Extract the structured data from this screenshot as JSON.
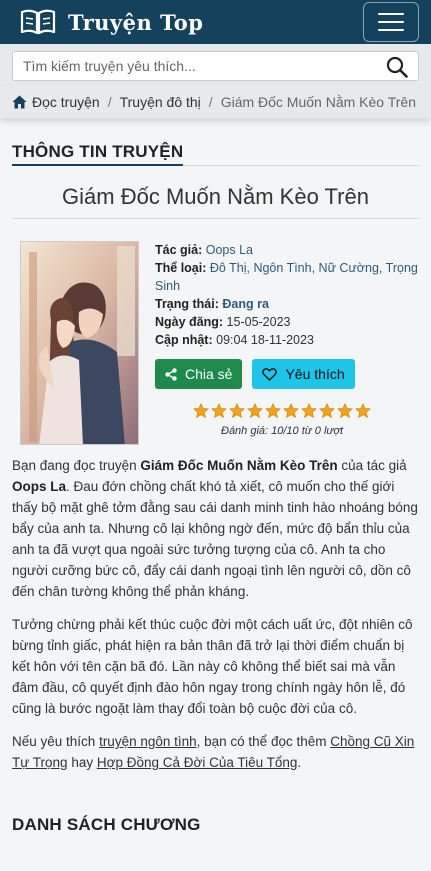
{
  "header": {
    "logo_text": "Truyện Top",
    "colors": {
      "bar": "#14425d",
      "share": "#1e8a4c",
      "favorite": "#1fc5e8",
      "star": "#f4a21b"
    }
  },
  "search": {
    "placeholder": "Tìm kiếm truyện yêu thích...",
    "value": ""
  },
  "breadcrumb": {
    "items": [
      "Đọc truyện",
      "Truyện đô thị"
    ],
    "current": "Giám Đốc Muốn Nằm Kèo Trên"
  },
  "section": {
    "info_title": "THÔNG TIN TRUYỆN",
    "chapters_title": "DANH SÁCH CHƯƠNG"
  },
  "story": {
    "title": "Giám Đốc Muốn Nằm Kèo Trên",
    "author_label": "Tác giả:",
    "author": "Oops La",
    "genre_label": "Thể loại:",
    "genres": [
      "Đô Thị",
      "Ngôn Tình",
      "Nữ Cường",
      "Trọng Sinh"
    ],
    "status_label": "Trạng thái:",
    "status": "Đang ra",
    "posted_label": "Ngày đăng:",
    "posted": "15-05-2023",
    "updated_label": "Cập nhật:",
    "updated": "09:04 18-11-2023",
    "share_label": "Chia sẻ",
    "favorite_label": "Yêu thích",
    "rating_stars_filled": 10,
    "rating_stars_total": 10,
    "rating_text": "Đánh giá: 10/10 từ 0 lượt"
  },
  "description": {
    "p1_intro": "Bạn đang đọc truyện ",
    "p1_title": "Giám Đốc Muốn Nằm Kèo Trên",
    "p1_mid": " của tác giả ",
    "p1_author": "Oops La",
    "p1_rest": ". Đau đớn chồng chất khó tả xiết, cô muốn cho thế giới thấy bộ mặt ghê tởm đằng sau cái danh minh tinh hào nhoáng bóng bẩy của anh ta. Nhưng cô lại không ngờ đến, mức độ bẩn thỉu của anh ta đã vượt qua ngoài sức tưởng tượng của cô. Anh ta cho người cưỡng bức cô, đẩy cái danh ngoại tình lên người cô, dồn cô đến chân tường không thể phản kháng.",
    "p2": "Tưởng chừng phải kết thúc cuộc đời một cách uất ức, đột nhiên cô bừng tỉnh giấc, phát hiện ra bản thân đã trở lại thời điểm chuẩn bị kết hôn với tên cặn bã đó. Lần này cô không thể biết sai mà vẫn đâm đầu, cô quyết định đào hôn ngay trong chính ngày hôn lễ, đó cũng là bước ngoặt làm thay đổi toàn bộ cuộc đời của cô.",
    "p3_a": "Nếu yêu thích ",
    "p3_link1": "truyện ngôn tình",
    "p3_b": ", bạn có thể đọc thêm ",
    "p3_link2": "Chồng Cũ Xin Tự Trọng",
    "p3_c": " hay ",
    "p3_link3": "Hợp Đồng Cả Đời Của Tiêu Tổng",
    "p3_d": "."
  }
}
